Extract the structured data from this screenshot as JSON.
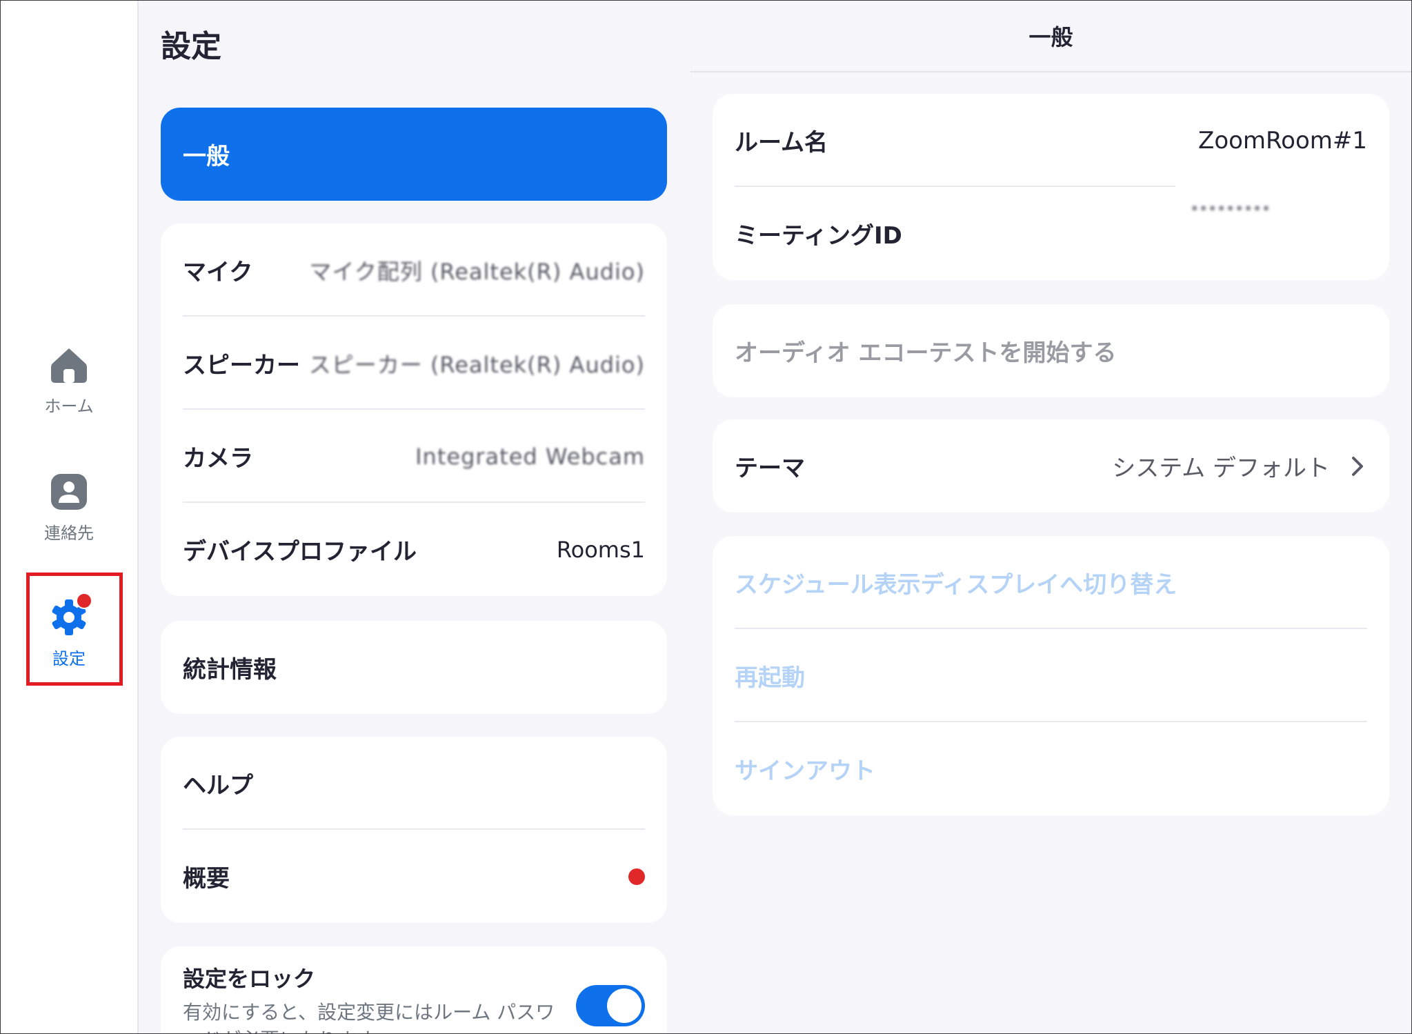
{
  "nav": {
    "items": [
      {
        "label": "ホーム",
        "icon": "home-icon"
      },
      {
        "label": "連絡先",
        "icon": "contact-icon"
      },
      {
        "label": "設定",
        "icon": "gear-icon",
        "active": true,
        "has_notification": true
      }
    ]
  },
  "settings": {
    "title": "設定",
    "selected_category": "一般",
    "devices": [
      {
        "label": "マイク",
        "value": "マイク配列 (Realtek(R) Audio)"
      },
      {
        "label": "スピーカー",
        "value": "スピーカー (Realtek(R) Audio)"
      },
      {
        "label": "カメラ",
        "value": "Integrated Webcam"
      },
      {
        "label": "デバイスプロファイル",
        "value": "Rooms1"
      }
    ],
    "stats_label": "統計情報",
    "help_label": "ヘルプ",
    "about_label": "概要",
    "lock": {
      "label": "設定をロック",
      "description": "有効にすると、設定変更にはルーム パスワードが必要になります。",
      "enabled": true
    }
  },
  "general": {
    "header": "一般",
    "room_name_label": "ルーム名",
    "room_name_value": "ZoomRoom#1",
    "meeting_id_label": "ミーティングID",
    "meeting_id_value": "•••••••••",
    "audio_echo_test": "オーディオ エコーテストを開始する",
    "theme_label": "テーマ",
    "theme_value": "システム デフォルト",
    "actions": [
      {
        "label": "スケジュール表示ディスプレイへ切り替え"
      },
      {
        "label": "再起動"
      },
      {
        "label": "サインアウト"
      }
    ]
  },
  "colors": {
    "accent": "#0e71eb",
    "notification": "#e02828",
    "highlight_box": "#e31b23",
    "disabled_text": "#b4d3f7"
  }
}
